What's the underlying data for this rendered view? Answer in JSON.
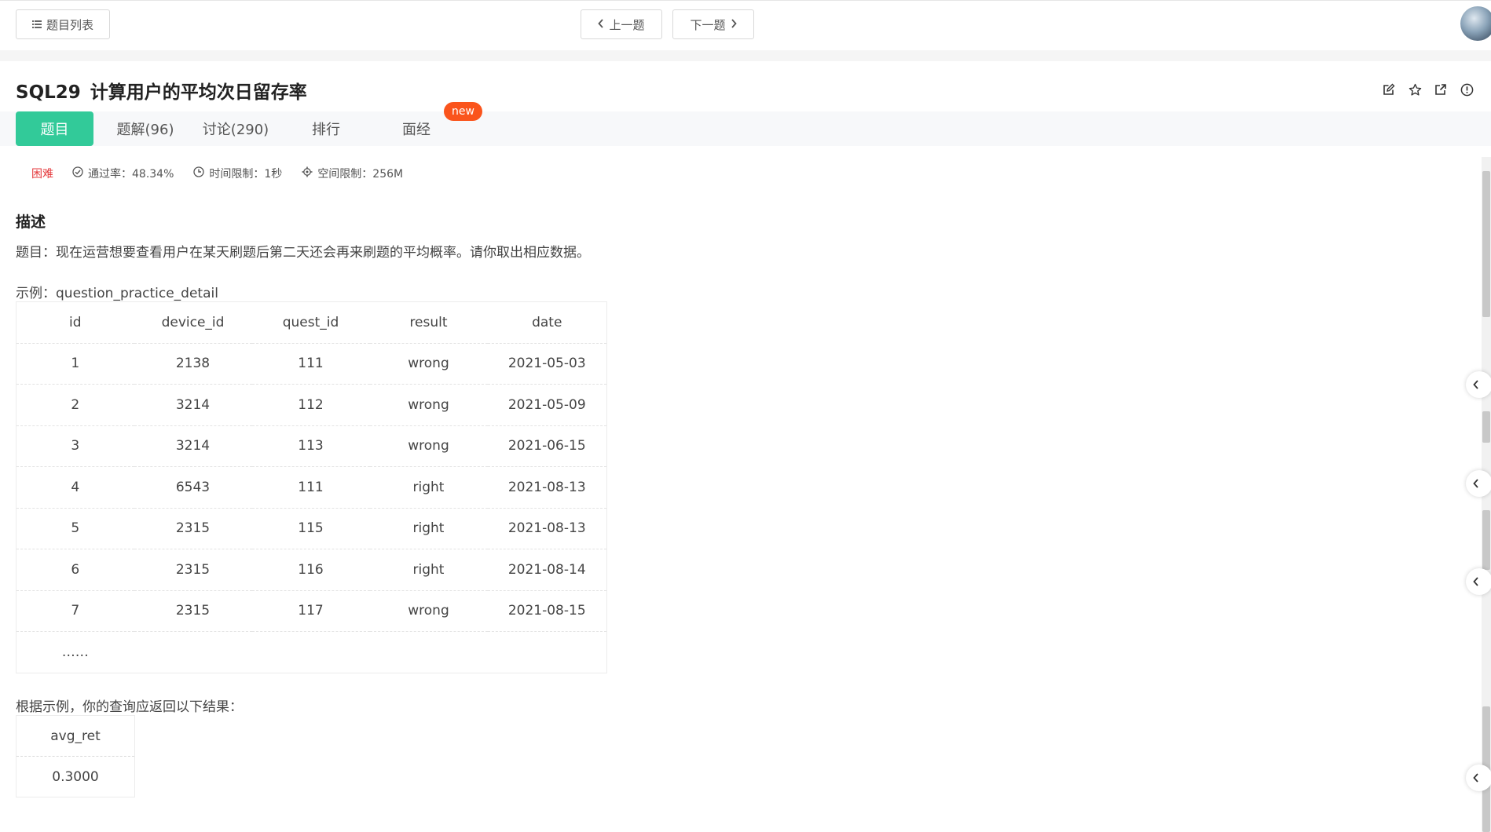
{
  "header": {
    "problem_list_label": "题目列表",
    "prev_label": "上一题",
    "next_label": "下一题"
  },
  "problem": {
    "code": "SQL29",
    "title": "计算用户的平均次日留存率"
  },
  "tabs": [
    {
      "label": "题目",
      "active": true
    },
    {
      "label": "题解(96)"
    },
    {
      "label": "讨论(290)"
    },
    {
      "label": "排行"
    },
    {
      "label": "面经"
    }
  ],
  "new_badge": "new",
  "meta": {
    "difficulty": "困难",
    "pass_rate": "通过率：48.34%",
    "time_limit": "时间限制：1秒",
    "space_limit": "空间限制：256M"
  },
  "description": {
    "heading": "描述",
    "text": "题目：现在运营想要查看用户在某天刷题后第二天还会再来刷题的平均概率。请你取出相应数据。",
    "example_label": "示例：question_practice_detail",
    "table": {
      "headers": [
        "id",
        "device_id",
        "quest_id",
        "result",
        "date"
      ],
      "rows": [
        [
          "1",
          "2138",
          "111",
          "wrong",
          "2021-05-03"
        ],
        [
          "2",
          "3214",
          "112",
          "wrong",
          "2021-05-09"
        ],
        [
          "3",
          "3214",
          "113",
          "wrong",
          "2021-06-15"
        ],
        [
          "4",
          "6543",
          "111",
          "right",
          "2021-08-13"
        ],
        [
          "5",
          "2315",
          "115",
          "right",
          "2021-08-13"
        ],
        [
          "6",
          "2315",
          "116",
          "right",
          "2021-08-14"
        ],
        [
          "7",
          "2315",
          "117",
          "wrong",
          "2021-08-15"
        ]
      ],
      "ellipsis": "……"
    },
    "result_label": "根据示例，你的查询应返回以下结果：",
    "result_table": {
      "header": "avg_ret",
      "value": "0.3000"
    }
  },
  "colors": {
    "accent": "#32ca99",
    "difficulty": "#e4393c",
    "badge": "#fa541c"
  }
}
